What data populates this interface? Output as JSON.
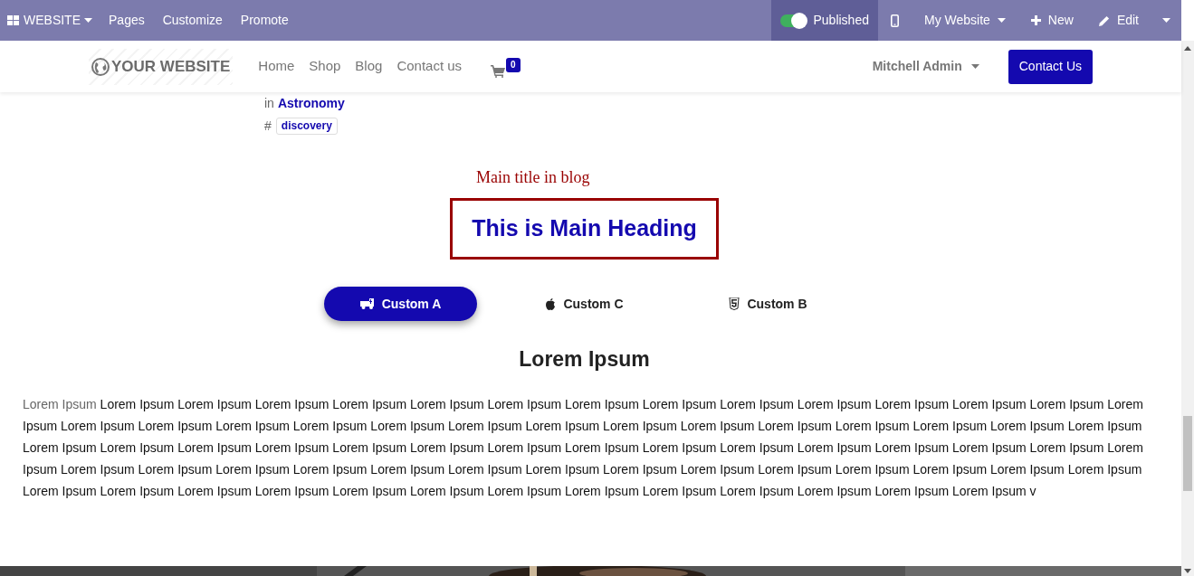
{
  "admin_bar": {
    "app_menu": "WEBSITE",
    "menu": [
      "Pages",
      "Customize",
      "Promote"
    ],
    "published": {
      "label": "Published",
      "on": true
    },
    "website_menu": "My Website",
    "new": "New",
    "edit": "Edit"
  },
  "header": {
    "logo": "YOUR WEBSITE",
    "nav": [
      "Home",
      "Shop",
      "Blog",
      "Contact us"
    ],
    "cart_count": "0",
    "user": "Mitchell Admin",
    "cta": "Contact Us"
  },
  "post_meta": {
    "category_prefix": "in",
    "category": "Astronomy",
    "tag_prefix": "#",
    "tag": "discovery"
  },
  "title_caption": "Main title in blog",
  "main_heading": "This is Main Heading",
  "tabs": [
    {
      "label": "Custom A",
      "selected": true
    },
    {
      "label": "Custom C",
      "selected": false
    },
    {
      "label": "Custom B",
      "selected": false
    }
  ],
  "section_title": "Lorem Ipsum",
  "paragraph_lead": "Lorem Ipsum",
  "paragraph_body": "Lorem Ipsum Lorem Ipsum Lorem Ipsum Lorem Ipsum Lorem Ipsum Lorem Ipsum Lorem Ipsum Lorem Ipsum Lorem Ipsum Lorem Ipsum Lorem Ipsum Lorem Ipsum Lorem Ipsum Lorem Ipsum Lorem Ipsum Lorem Ipsum Lorem Ipsum Lorem Ipsum Lorem Ipsum Lorem Ipsum Lorem Ipsum Lorem Ipsum Lorem Ipsum Lorem Ipsum Lorem Ipsum Lorem Ipsum Lorem Ipsum Lorem Ipsum Lorem Ipsum Lorem Ipsum Lorem Ipsum Lorem Ipsum Lorem Ipsum Lorem Ipsum Lorem Ipsum Lorem Ipsum Lorem Ipsum Lorem Ipsum Lorem Ipsum Lorem Ipsum Lorem Ipsum Lorem Ipsum Lorem Ipsum Lorem Ipsum Lorem Ipsum Lorem Ipsum Lorem Ipsum Lorem Ipsum Lorem Ipsum Lorem Ipsum Lorem Ipsum Lorem Ipsum Lorem Ipsum Lorem Ipsum Lorem Ipsum Lorem Ipsum Lorem Ipsum Lorem Ipsum Lorem Ipsum Lorem Ipsum Lorem Ipsum Lorem Ipsum Lorem Ipsum Lorem Ipsum Lorem Ipsum Lorem Ipsum Lorem Ipsum Lorem Ipsum Lorem Ipsum Lorem Ipsum v"
}
